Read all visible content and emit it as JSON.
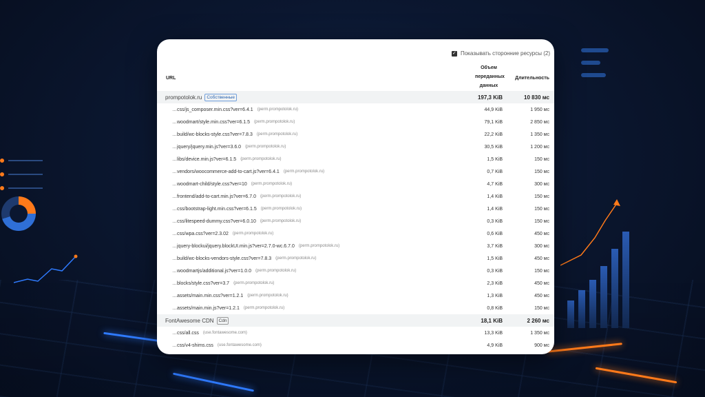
{
  "colors": {
    "accent_blue": "#2f7bff",
    "accent_orange": "#ff7a1a",
    "badge_blue": "#2a64b0"
  },
  "toolbar": {
    "show_third_party_label": "Показывать сторонние ресурсы (2)",
    "checked": true
  },
  "table": {
    "headers": {
      "url": "URL",
      "size": "Объем переданных данных",
      "duration": "Длительность"
    },
    "groups": [
      {
        "name": "prompotolok.ru",
        "badge": "Собственные",
        "badge_style": "blue",
        "size": "197,3 KiB",
        "duration": "10 830 мс",
        "rows": [
          {
            "url": "…css/js_composer.min.css?ver=6.4.1",
            "host": "(perm.prompotolok.ru)",
            "size": "44,9 KiB",
            "duration": "1 950 мс"
          },
          {
            "url": "…woodmart/style.min.css?ver=6.1.5",
            "host": "(perm.prompotolok.ru)",
            "size": "79,1 KiB",
            "duration": "2 850 мс"
          },
          {
            "url": "…build/wc-blocks-style.css?ver=7.8.3",
            "host": "(perm.prompotolok.ru)",
            "size": "22,2 KiB",
            "duration": "1 350 мс"
          },
          {
            "url": "…jquery/jquery.min.js?ver=3.6.0",
            "host": "(perm.prompotolok.ru)",
            "size": "30,5 KiB",
            "duration": "1 200 мс"
          },
          {
            "url": "…libs/device.min.js?ver=6.1.5",
            "host": "(perm.prompotolok.ru)",
            "size": "1,5 KiB",
            "duration": "150 мс"
          },
          {
            "url": "…vendors/woocommerce-add-to-cart.js?ver=6.4.1",
            "host": "(perm.prompotolok.ru)",
            "size": "0,7 KiB",
            "duration": "150 мс"
          },
          {
            "url": "…woodmart-child/style.css?ver=10",
            "host": "(perm.prompotolok.ru)",
            "size": "4,7 KiB",
            "duration": "300 мс"
          },
          {
            "url": "…frontend/add-to-cart.min.js?ver=6.7.0",
            "host": "(perm.prompotolok.ru)",
            "size": "1,4 KiB",
            "duration": "150 мс"
          },
          {
            "url": "…css/bootstrap-light.min.css?ver=6.1.5",
            "host": "(perm.prompotolok.ru)",
            "size": "1,4 KiB",
            "duration": "150 мс"
          },
          {
            "url": "…css/litespeed-dummy.css?ver=6.0.10",
            "host": "(perm.prompotolok.ru)",
            "size": "0,3 KiB",
            "duration": "150 мс"
          },
          {
            "url": "…css/wpa.css?ver=2.3.02",
            "host": "(perm.prompotolok.ru)",
            "size": "0,6 KiB",
            "duration": "450 мс"
          },
          {
            "url": "…jquery-blockui/jquery.blockUI.min.js?ver=2.7.0-wc.6.7.0",
            "host": "(perm.prompotolok.ru)",
            "size": "3,7 KiB",
            "duration": "300 мс"
          },
          {
            "url": "…build/wc-blocks-vendors-style.css?ver=7.8.3",
            "host": "(perm.prompotolok.ru)",
            "size": "1,5 KiB",
            "duration": "450 мс"
          },
          {
            "url": "…woodmartjs/additional.js?ver=1.0.0",
            "host": "(perm.prompotolok.ru)",
            "size": "0,3 KiB",
            "duration": "150 мс"
          },
          {
            "url": "…blocks/style.css?ver=3.7",
            "host": "(perm.prompotolok.ru)",
            "size": "2,3 KiB",
            "duration": "450 мс"
          },
          {
            "url": "…assets/main.min.css?ver=1.2.1",
            "host": "(perm.prompotolok.ru)",
            "size": "1,3 KiB",
            "duration": "450 мс"
          },
          {
            "url": "…assets/main.min.js?ver=1.2.1",
            "host": "(perm.prompotolok.ru)",
            "size": "0,8 KiB",
            "duration": "150 мс"
          }
        ]
      },
      {
        "name": "FontAwesome CDN",
        "badge": "Cdn",
        "badge_style": "gray",
        "size": "18,1 KiB",
        "duration": "2 260 мс",
        "rows": [
          {
            "url": "…css/all.css",
            "host": "(use.fontawesome.com)",
            "size": "13,3 KiB",
            "duration": "1 350 мс"
          },
          {
            "url": "…css/v4-shims.css",
            "host": "(use.fontawesome.com)",
            "size": "4,9 KiB",
            "duration": "900 мс"
          }
        ]
      }
    ]
  }
}
